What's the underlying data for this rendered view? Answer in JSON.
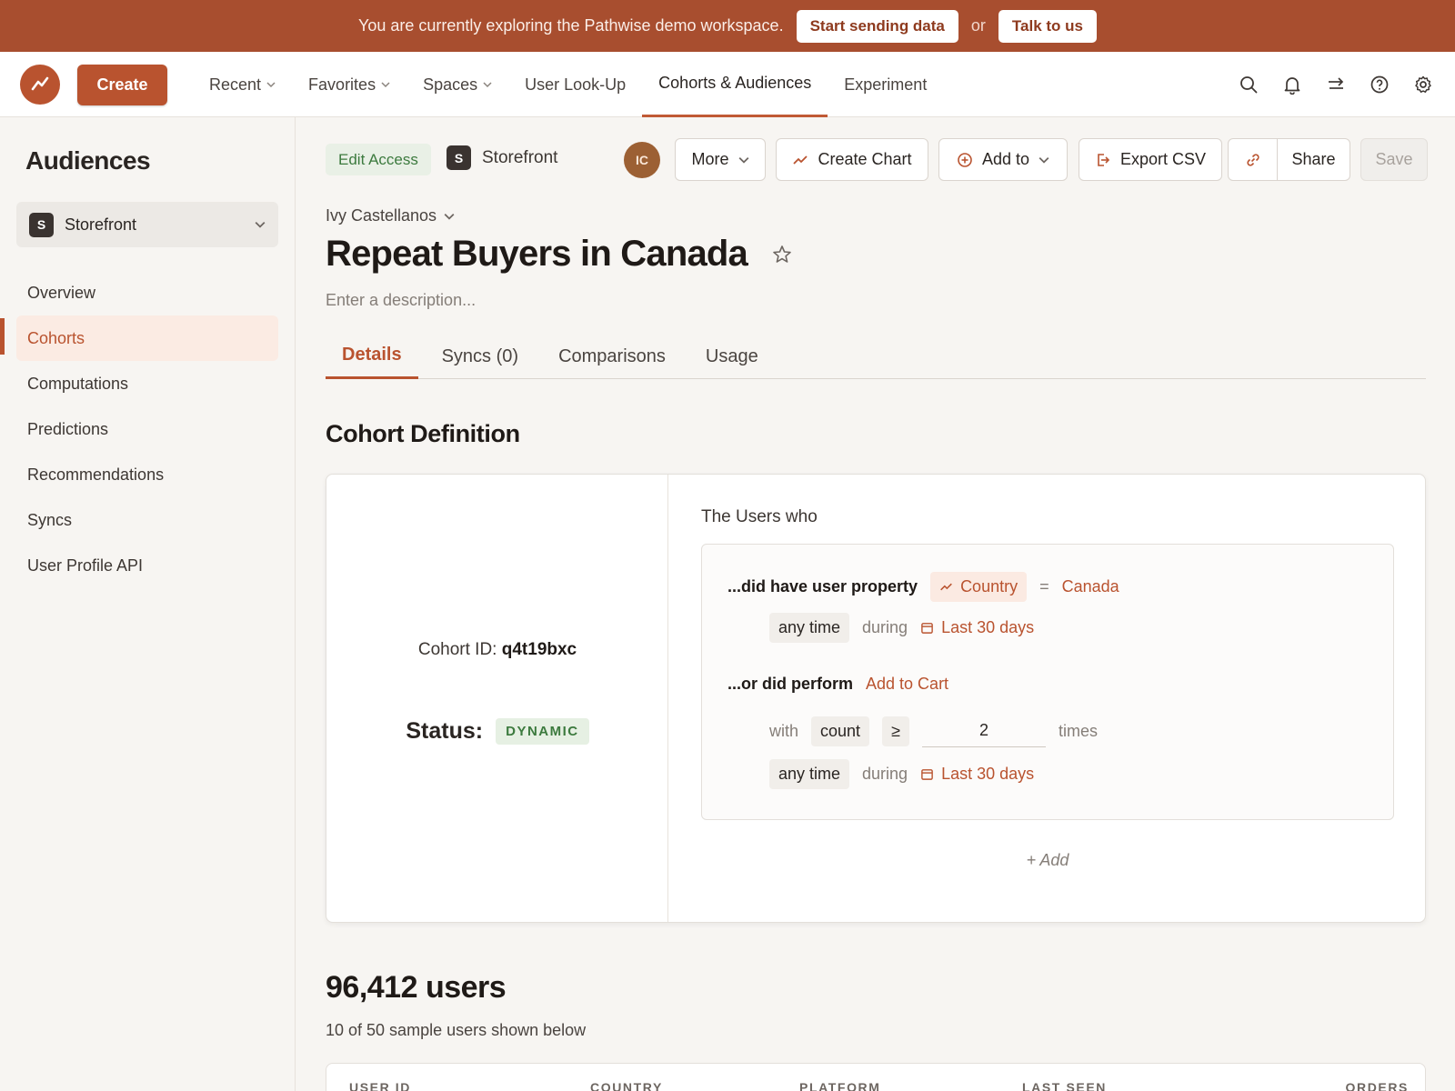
{
  "banner": {
    "message": "You are currently exploring the Pathwise demo workspace.",
    "primary_cta": "Start sending data",
    "or": "or",
    "secondary_cta": "Talk to us"
  },
  "topnav": {
    "create_label": "Create",
    "items": [
      {
        "label": "Recent",
        "dropdown": true
      },
      {
        "label": "Favorites",
        "dropdown": true
      },
      {
        "label": "Spaces",
        "dropdown": true
      },
      {
        "label": "User Look-Up",
        "dropdown": false
      },
      {
        "label": "Cohorts & Audiences",
        "dropdown": false,
        "active": true
      },
      {
        "label": "Experiment",
        "dropdown": false
      }
    ],
    "icons": [
      "search-icon",
      "bell-icon",
      "transfer-icon",
      "help-icon",
      "gear-icon"
    ]
  },
  "sidebar": {
    "title": "Audiences",
    "workspace": {
      "initial": "S",
      "name": "Storefront"
    },
    "items": [
      {
        "label": "Overview"
      },
      {
        "label": "Cohorts",
        "active": true
      },
      {
        "label": "Computations"
      },
      {
        "label": "Predictions"
      },
      {
        "label": "Recommendations"
      },
      {
        "label": "Syncs"
      },
      {
        "label": "User Profile API"
      }
    ]
  },
  "toolbar": {
    "edit_access": "Edit Access",
    "workspace_initial": "S",
    "workspace_name": "Storefront",
    "avatar_initials": "IC",
    "more": "More",
    "create_chart": "Create Chart",
    "add_to": "Add to",
    "export_csv": "Export CSV",
    "share": "Share",
    "save": "Save"
  },
  "cohort": {
    "owner": "Ivy Castellanos",
    "title": "Repeat Buyers in Canada",
    "description_placeholder": "Enter a description...",
    "tabs": [
      {
        "label": "Details",
        "active": true
      },
      {
        "label": "Syncs (0)"
      },
      {
        "label": "Comparisons"
      },
      {
        "label": "Usage"
      }
    ],
    "section_title": "Cohort Definition",
    "id_label": "Cohort ID:",
    "id_value": "q4t19bxc",
    "status_label": "Status:",
    "status_value": "DYNAMIC",
    "definition": {
      "heading": "The Users who",
      "rule1": {
        "prefix": "...did have user property",
        "property": "Country",
        "operator": "=",
        "value": "Canada",
        "time": "any time",
        "during": "during",
        "range": "Last 30 days"
      },
      "rule2": {
        "prefix": "...or did perform",
        "event": "Add to Cart",
        "with": "with",
        "metric": "count",
        "comparator": "≥",
        "count": "2",
        "times": "times",
        "time": "any time",
        "during": "during",
        "range": "Last 30 days"
      },
      "add_label": "+ Add"
    }
  },
  "users": {
    "count_label": "96,412 users",
    "sample_label": "10 of 50 sample users shown below",
    "columns": [
      "USER ID",
      "COUNTRY",
      "PLATFORM",
      "LAST SEEN",
      "ORDERS"
    ]
  }
}
